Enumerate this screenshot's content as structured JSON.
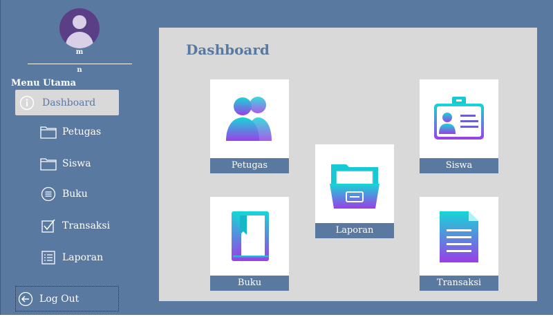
{
  "sidebar": {
    "user_top": "m",
    "user_bottom": "n",
    "menu_title": "Menu Utama",
    "items": [
      {
        "label": "Dashboard",
        "icon": "info-icon"
      },
      {
        "label": "Petugas",
        "icon": "folder-icon"
      },
      {
        "label": "Siswa",
        "icon": "folder-icon"
      },
      {
        "label": "Buku",
        "icon": "list-circle-icon"
      },
      {
        "label": "Transaksi",
        "icon": "checkbox-icon"
      },
      {
        "label": "Laporan",
        "icon": "checklist-icon"
      }
    ],
    "logout_label": "Log Out"
  },
  "main": {
    "title": "Dashboard",
    "tiles": [
      {
        "label": "Petugas",
        "icon": "users-icon"
      },
      {
        "label": "Siswa",
        "icon": "id-card-icon"
      },
      {
        "label": "Laporan",
        "icon": "file-cabinet-icon"
      },
      {
        "label": "Buku",
        "icon": "book-icon"
      },
      {
        "label": "Transaksi",
        "icon": "document-icon"
      }
    ]
  },
  "colors": {
    "background": "#5a79a0",
    "panel": "#d9d9d9",
    "accent": "#5a79a0",
    "gradient_start": "#16d6d6",
    "gradient_end": "#9b3fe6"
  }
}
